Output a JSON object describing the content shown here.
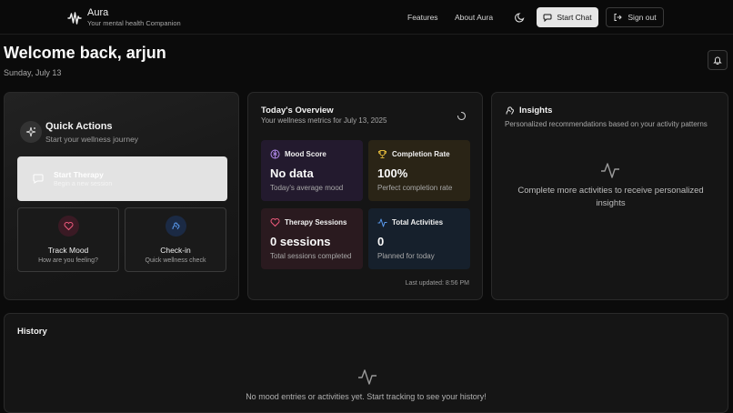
{
  "header": {
    "brand_name": "Aura",
    "brand_tagline": "Your mental health Companion",
    "nav": [
      "Features",
      "About Aura"
    ],
    "start_chat": "Start Chat",
    "sign_out": "Sign out"
  },
  "welcome": {
    "title": "Welcome back, arjun",
    "date": "Sunday, July 13"
  },
  "quick_actions": {
    "title": "Quick Actions",
    "subtitle": "Start your wellness journey",
    "therapy": {
      "title": "Start Therapy",
      "subtitle": "Begin a new session"
    },
    "track_mood": {
      "title": "Track Mood",
      "subtitle": "How are you feeling?"
    },
    "checkin": {
      "title": "Check-in",
      "subtitle": "Quick wellness check"
    }
  },
  "overview": {
    "title": "Today's Overview",
    "subtitle": "Your wellness metrics for July 13, 2025",
    "tiles": [
      {
        "label": "Mood Score",
        "value": "No data",
        "sub": "Today's average mood",
        "icon": "brain-icon",
        "bg": "#231a2e",
        "accent": "#b58cf0"
      },
      {
        "label": "Completion Rate",
        "value": "100%",
        "sub": "Perfect completion rate",
        "icon": "trophy-icon",
        "bg": "#2a2416",
        "accent": "#e2b93b"
      },
      {
        "label": "Therapy Sessions",
        "value": "0 sessions",
        "sub": "Total sessions completed",
        "icon": "heart-icon",
        "bg": "#2a1a1f",
        "accent": "#ef5a7c"
      },
      {
        "label": "Total Activities",
        "value": "0",
        "sub": "Planned for today",
        "icon": "activity-icon",
        "bg": "#16202c",
        "accent": "#5b9bef"
      }
    ],
    "updated": "Last updated: 8:56 PM"
  },
  "insights": {
    "title": "Insights",
    "subtitle": "Personalized recommendations based on your activity patterns",
    "empty": "Complete more activities to receive personalized insights"
  },
  "history": {
    "title": "History",
    "empty": "No mood entries or activities yet. Start tracking to see your history!"
  },
  "colors": {
    "background": "#0b0b0b",
    "card": "#151515",
    "border": "#2a2a2a",
    "track_mood_accent": "#ef5a7c",
    "checkin_accent": "#5b9bef"
  }
}
